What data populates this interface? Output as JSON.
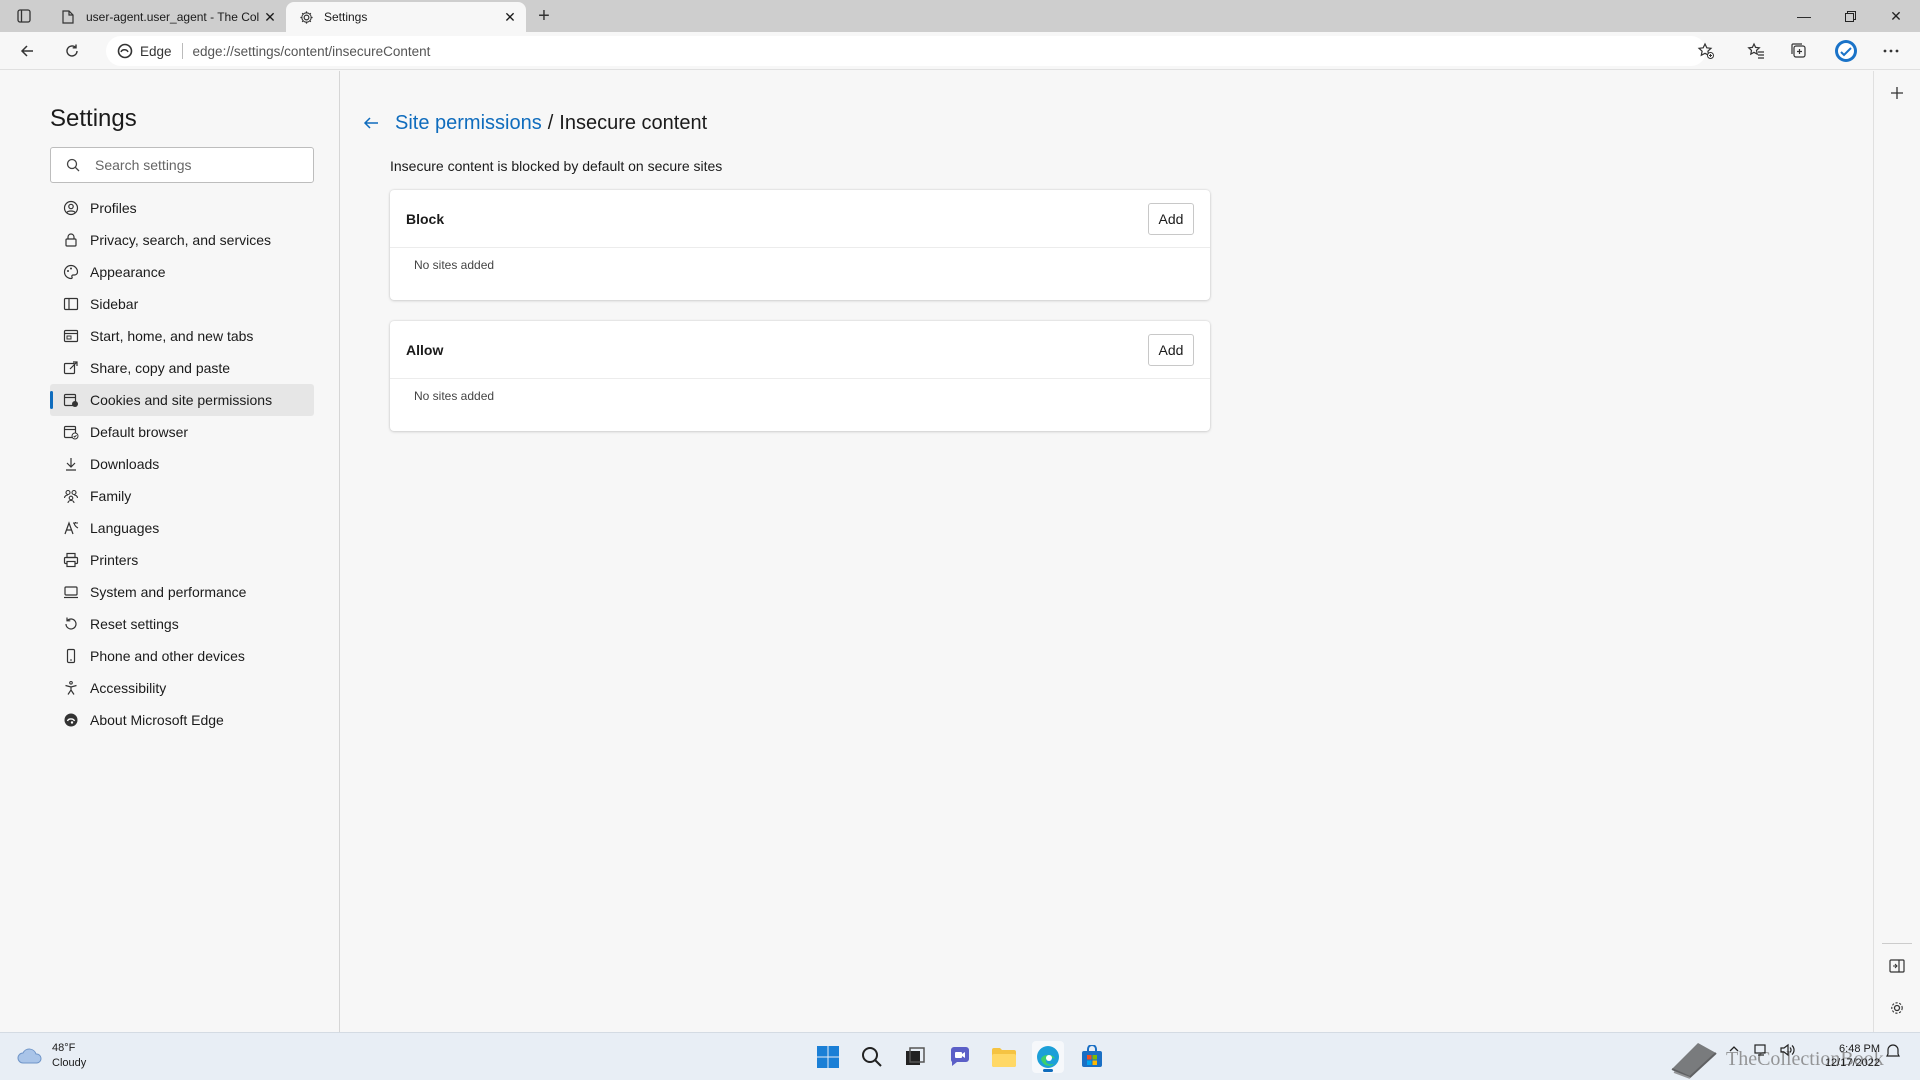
{
  "browser": {
    "tabs": [
      {
        "title": "user-agent.user_agent - The Coll",
        "active": false,
        "icon": "page-icon"
      },
      {
        "title": "Settings",
        "active": true,
        "icon": "gear-icon"
      }
    ],
    "address": {
      "site_label": "Edge",
      "url": "edge://settings/content/insecureContent"
    }
  },
  "sidebar": {
    "title": "Settings",
    "search_placeholder": "Search settings",
    "items": [
      {
        "label": "Profiles",
        "icon": "profile-icon"
      },
      {
        "label": "Privacy, search, and services",
        "icon": "lock-icon"
      },
      {
        "label": "Appearance",
        "icon": "appearance-icon"
      },
      {
        "label": "Sidebar",
        "icon": "sidebar-icon"
      },
      {
        "label": "Start, home, and new tabs",
        "icon": "home-tabs-icon"
      },
      {
        "label": "Share, copy and paste",
        "icon": "share-icon"
      },
      {
        "label": "Cookies and site permissions",
        "icon": "cookies-icon",
        "active": true
      },
      {
        "label": "Default browser",
        "icon": "default-browser-icon"
      },
      {
        "label": "Downloads",
        "icon": "download-icon"
      },
      {
        "label": "Family",
        "icon": "family-icon"
      },
      {
        "label": "Languages",
        "icon": "languages-icon"
      },
      {
        "label": "Printers",
        "icon": "printer-icon"
      },
      {
        "label": "System and performance",
        "icon": "system-icon"
      },
      {
        "label": "Reset settings",
        "icon": "reset-icon"
      },
      {
        "label": "Phone and other devices",
        "icon": "phone-icon"
      },
      {
        "label": "Accessibility",
        "icon": "accessibility-icon"
      },
      {
        "label": "About Microsoft Edge",
        "icon": "edge-logo-icon"
      }
    ]
  },
  "main": {
    "breadcrumb_parent": "Site permissions",
    "breadcrumb_sep": "/",
    "breadcrumb_current": "Insecure content",
    "description": "Insecure content is blocked by default on secure sites",
    "sections": [
      {
        "title": "Block",
        "button": "Add",
        "empty_text": "No sites added"
      },
      {
        "title": "Allow",
        "button": "Add",
        "empty_text": "No sites added"
      }
    ]
  },
  "taskbar": {
    "weather_temp": "48°F",
    "weather_desc": "Cloudy",
    "time": "6:48 PM",
    "date": "12/17/2022",
    "watermark": "TheCollectionBook"
  },
  "colors": {
    "accent": "#0f6cbd",
    "background": "#f7f7f7",
    "tabbar": "#cecece"
  }
}
